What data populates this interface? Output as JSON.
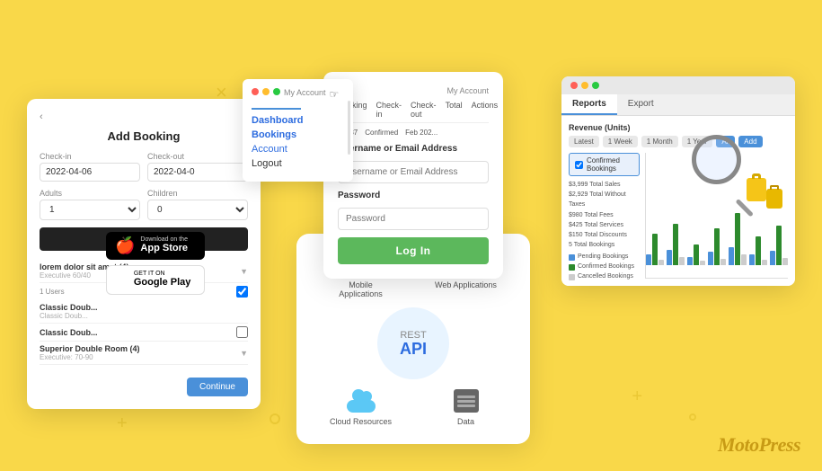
{
  "page": {
    "bg_color": "#F9D849",
    "brand": "MotoPress"
  },
  "booking_widget": {
    "title": "Add Booking",
    "back_label": "< Back",
    "checkin_label": "Check-in",
    "checkout_label": "Check-out",
    "checkin_value": "2022-04-06",
    "checkout_value": "2022-04-0",
    "adults_label": "Adults",
    "adults_value": "1",
    "children_label": "Children",
    "children_value": "0",
    "search_btn": "Search",
    "lorem_text": "lorem dolor sit amet (4)",
    "lorem_sub": "Executive 60/40",
    "rooms": [
      {
        "name": "Classic Doub...",
        "sub": "Classic Doub..."
      },
      {
        "name": "Classic Doub...",
        "sub": ""
      },
      {
        "name": "Superior Double Room (4)",
        "sub": "Executive: 70-90"
      }
    ],
    "continue_btn": "Continue"
  },
  "app_badges": {
    "appstore_top": "Download on the",
    "appstore_main": "App Store",
    "google_top": "GET IT ON",
    "google_main": "Google Play"
  },
  "dropdown_menu": {
    "items": [
      {
        "label": "Dashboard",
        "type": "link"
      },
      {
        "label": "Bookings",
        "type": "link"
      },
      {
        "label": "Account",
        "type": "link"
      },
      {
        "label": "Logout",
        "type": "plain"
      }
    ],
    "my_account": "My Account"
  },
  "login_form": {
    "header": "My Account",
    "table_cols": [
      "Booking",
      "Check-in",
      "Check-out",
      "Total",
      "Actions"
    ],
    "row_id": "#1787",
    "row_status": "Confirmed",
    "row_checkin": "Feb 202...",
    "username_label": "Username or Email Address",
    "username_placeholder": "Username or Email Address",
    "password_label": "Password",
    "password_placeholder": "Password",
    "login_btn": "Log In"
  },
  "api_diagram": {
    "center_label": "REST\nAPI",
    "items": [
      {
        "label": "Mobile\nApplications",
        "icon": "phone"
      },
      {
        "label": "Web Applications",
        "icon": "monitor"
      },
      {
        "label": "Cloud Resources",
        "icon": "cloud"
      },
      {
        "label": "Data",
        "icon": "server"
      }
    ]
  },
  "reports_panel": {
    "tabs": [
      "Reports",
      "Export"
    ],
    "active_tab": "Reports",
    "section_title": "Revenue (Units)",
    "filters": [
      "Latest",
      "1 Week",
      "1 Month",
      "1 Year",
      "All"
    ],
    "active_filter": "All",
    "add_filter_label": "Add",
    "checkbox_label": "Confirmed Bookings",
    "stats": [
      "$3,999 Total Sales",
      "$2,929 Total Without Taxes",
      "$980 Total Fees",
      "$425 Total Services",
      "$150 Total Discounts",
      "5 Total Bookings"
    ],
    "legend": [
      {
        "color": "#4a90d9",
        "label": "Pending Bookings"
      },
      {
        "color": "#2d8a2d",
        "label": "Confirmed Bookings"
      },
      {
        "color": "#e8e8e8",
        "label": "Cancelled Bookings"
      }
    ],
    "bars": [
      {
        "blue": 20,
        "green": 60,
        "gray": 10
      },
      {
        "blue": 30,
        "green": 80,
        "gray": 15
      },
      {
        "blue": 15,
        "green": 40,
        "gray": 8
      },
      {
        "blue": 25,
        "green": 70,
        "gray": 12
      },
      {
        "blue": 35,
        "green": 100,
        "gray": 20
      },
      {
        "blue": 20,
        "green": 55,
        "gray": 10
      },
      {
        "blue": 28,
        "green": 75,
        "gray": 14
      }
    ]
  }
}
